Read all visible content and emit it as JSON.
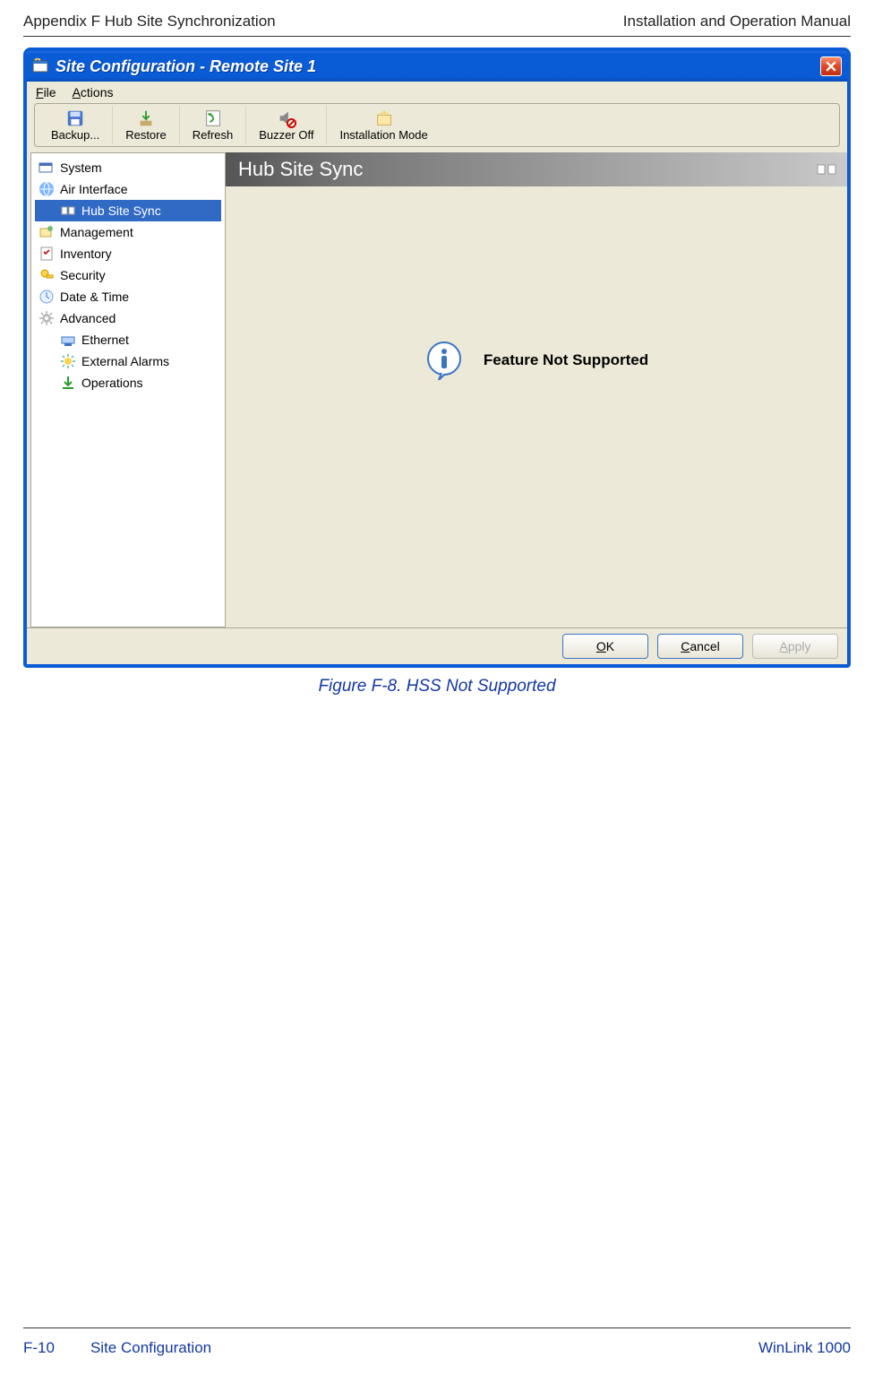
{
  "page": {
    "header_left": "Appendix F  Hub Site Synchronization",
    "header_right": "Installation and Operation Manual",
    "footer_left": "F-10",
    "footer_center": "Site Configuration",
    "footer_right": "WinLink 1000",
    "caption": "Figure F-8.  HSS Not Supported"
  },
  "window": {
    "title": "Site Configuration - Remote Site 1",
    "menu": {
      "file": "File",
      "actions": "Actions"
    },
    "toolbar": {
      "backup": "Backup...",
      "restore": "Restore",
      "refresh": "Refresh",
      "buzzer": "Buzzer Off",
      "install": "Installation Mode"
    },
    "nav": {
      "system": "System",
      "air": "Air Interface",
      "hss": "Hub Site Sync",
      "mgmt": "Management",
      "inv": "Inventory",
      "sec": "Security",
      "dt": "Date & Time",
      "adv": "Advanced",
      "eth": "Ethernet",
      "ext": "External Alarms",
      "ops": "Operations"
    },
    "content": {
      "header": "Hub Site Sync",
      "message": "Feature Not Supported"
    },
    "buttons": {
      "ok": "OK",
      "cancel": "Cancel",
      "apply": "Apply"
    }
  }
}
